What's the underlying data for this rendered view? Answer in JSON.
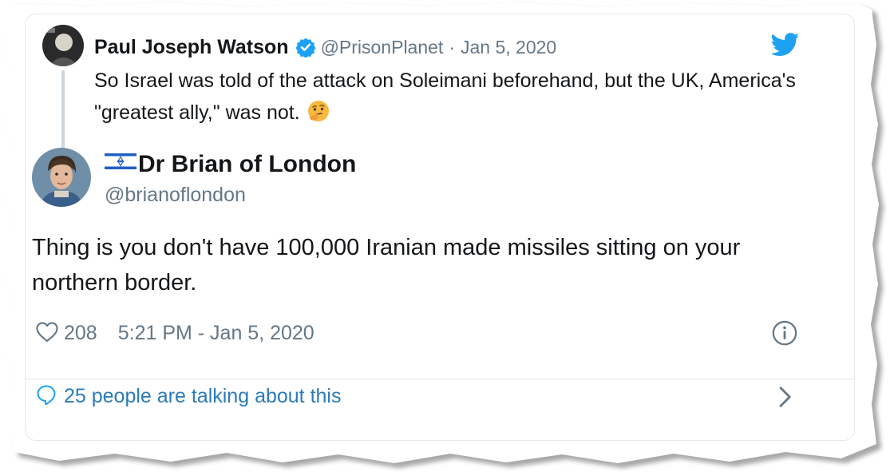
{
  "quoted_tweet": {
    "author_name": "Paul Joseph Watson",
    "handle": "@PrisonPlanet",
    "separator": "·",
    "date": "Jan 5, 2020",
    "text": "So Israel was told of the attack on Soleimani beforehand, but the UK, America's \"greatest ally,\" was not.",
    "emoji_icon": "thinking-face-icon",
    "verified_icon": "verified-badge-icon"
  },
  "tweet": {
    "author_name": "Dr Brian of London",
    "flag_icon": "israel-flag-icon",
    "handle": "@brianoflondon",
    "text": "Thing is you don't have 100,000 Iranian made missiles sitting on your northern border.",
    "likes": "208",
    "timestamp": "5:21 PM - Jan 5, 2020"
  },
  "footer": {
    "conversation_label": "25 people are talking about this"
  },
  "colors": {
    "twitter_blue": "#1da1f2",
    "link_blue": "#2b7bb9",
    "text_primary": "#14171a",
    "text_secondary": "#657786",
    "border": "#e1e8ed"
  }
}
